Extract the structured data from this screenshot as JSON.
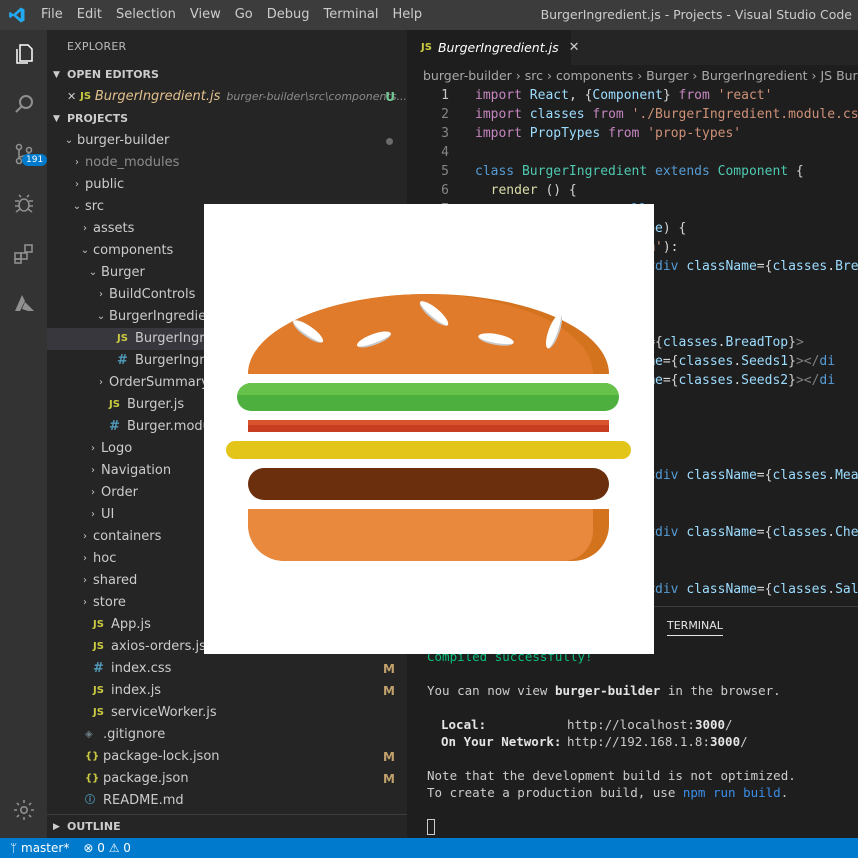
{
  "titlebar": {
    "menu": [
      "File",
      "Edit",
      "Selection",
      "View",
      "Go",
      "Debug",
      "Terminal",
      "Help"
    ],
    "title": "BurgerIngredient.js - Projects - Visual Studio Code"
  },
  "activity": {
    "icons": [
      "explorer-icon",
      "search-icon",
      "source-control-icon",
      "debug-icon",
      "extensions-icon",
      "azure-icon",
      "settings-gear-icon"
    ],
    "scm_badge": "191"
  },
  "sidebar": {
    "title": "EXPLORER",
    "open_editors_label": "OPEN EDITORS",
    "open_editor": {
      "close": "✕",
      "icon": "JS",
      "name": "BurgerIngredient.js",
      "path": "burger-builder\\src\\components...",
      "status": "U"
    },
    "projects_label": "PROJECTS",
    "tree": [
      {
        "indent": 0,
        "chev": "⌄",
        "icon": "",
        "name": "burger-builder",
        "mark": "",
        "dot": true
      },
      {
        "indent": 1,
        "chev": "›",
        "icon": "",
        "name": "node_modules",
        "mark": "",
        "dim": true
      },
      {
        "indent": 1,
        "chev": "›",
        "icon": "",
        "name": "public",
        "mark": ""
      },
      {
        "indent": 1,
        "chev": "⌄",
        "icon": "",
        "name": "src",
        "mark": ""
      },
      {
        "indent": 2,
        "chev": "›",
        "icon": "",
        "name": "assets",
        "mark": ""
      },
      {
        "indent": 2,
        "chev": "⌄",
        "icon": "",
        "name": "components",
        "mark": ""
      },
      {
        "indent": 3,
        "chev": "⌄",
        "icon": "",
        "name": "Burger",
        "mark": ""
      },
      {
        "indent": 4,
        "chev": "›",
        "icon": "",
        "name": "BuildControls",
        "mark": ""
      },
      {
        "indent": 4,
        "chev": "⌄",
        "icon": "",
        "name": "BurgerIngredient",
        "mark": ""
      },
      {
        "indent": 5,
        "chev": "",
        "icon": "JS",
        "name": "BurgerIngredient.js",
        "mark": "",
        "selected": true
      },
      {
        "indent": 5,
        "chev": "",
        "icon": "#",
        "name": "BurgerIngredient.module.css",
        "mark": ""
      },
      {
        "indent": 4,
        "chev": "›",
        "icon": "",
        "name": "OrderSummary",
        "mark": ""
      },
      {
        "indent": 4,
        "chev": "",
        "icon": "JS",
        "name": "Burger.js",
        "mark": ""
      },
      {
        "indent": 4,
        "chev": "",
        "icon": "#",
        "name": "Burger.module.css",
        "mark": ""
      },
      {
        "indent": 3,
        "chev": "›",
        "icon": "",
        "name": "Logo",
        "mark": ""
      },
      {
        "indent": 3,
        "chev": "›",
        "icon": "",
        "name": "Navigation",
        "mark": ""
      },
      {
        "indent": 3,
        "chev": "›",
        "icon": "",
        "name": "Order",
        "mark": ""
      },
      {
        "indent": 3,
        "chev": "›",
        "icon": "",
        "name": "UI",
        "mark": ""
      },
      {
        "indent": 2,
        "chev": "›",
        "icon": "",
        "name": "containers",
        "mark": ""
      },
      {
        "indent": 2,
        "chev": "›",
        "icon": "",
        "name": "hoc",
        "mark": ""
      },
      {
        "indent": 2,
        "chev": "›",
        "icon": "",
        "name": "shared",
        "mark": ""
      },
      {
        "indent": 2,
        "chev": "›",
        "icon": "",
        "name": "store",
        "mark": ""
      },
      {
        "indent": 2,
        "chev": "",
        "icon": "JS",
        "name": "App.js",
        "mark": ""
      },
      {
        "indent": 2,
        "chev": "",
        "icon": "JS",
        "name": "axios-orders.js",
        "mark": ""
      },
      {
        "indent": 2,
        "chev": "",
        "icon": "#",
        "name": "index.css",
        "mark": "M"
      },
      {
        "indent": 2,
        "chev": "",
        "icon": "JS",
        "name": "index.js",
        "mark": "M"
      },
      {
        "indent": 2,
        "chev": "",
        "icon": "JS",
        "name": "serviceWorker.js",
        "mark": ""
      },
      {
        "indent": 1,
        "chev": "",
        "icon": "◈",
        "name": ".gitignore",
        "mark": ""
      },
      {
        "indent": 1,
        "chev": "",
        "icon": "{}",
        "name": "package-lock.json",
        "mark": "M"
      },
      {
        "indent": 1,
        "chev": "",
        "icon": "{}",
        "name": "package.json",
        "mark": "M"
      },
      {
        "indent": 1,
        "chev": "",
        "icon": "ⓘ",
        "name": "README.md",
        "mark": ""
      }
    ],
    "outline_label": "OUTLINE"
  },
  "editor": {
    "tab": {
      "icon": "JS",
      "label": "BurgerIngredient.js",
      "close": "✕"
    },
    "breadcrumb": [
      "burger-builder",
      "src",
      "components",
      "Burger",
      "BurgerIngredient",
      "JS Burg"
    ],
    "lines": [
      {
        "n": 1,
        "html": "<span class='kw2'>import</span> <span class='attr'>React</span>, {<span class='attr'>Component</span>} <span class='kw2'>from</span> <span class='str'>'react'</span>"
      },
      {
        "n": 2,
        "html": "<span class='kw2'>import</span> <span class='attr'>classes</span> <span class='kw2'>from</span> <span class='str'>'./BurgerIngredient.module.css'</span>"
      },
      {
        "n": 3,
        "html": "<span class='kw2'>import</span> <span class='attr'>PropTypes</span> <span class='kw2'>from</span> <span class='str'>'prop-types'</span>"
      },
      {
        "n": 4,
        "html": ""
      },
      {
        "n": 5,
        "html": "<span class='kw'>class</span> <span class='cls'>BurgerIngredient</span> <span class='kw'>extends</span> <span class='cls'>Component</span> {"
      },
      {
        "n": 6,
        "html": "  <span class='fn'>render</span> () {"
      },
      {
        "n": 7,
        "html": "                    <span class='kw'>ll</span>"
      },
      {
        "n": 8,
        "html": "                   .<span class='attr'>type</span>) {"
      },
      {
        "n": 9,
        "html": "                   <span class='str'>ttom'</span>):"
      },
      {
        "n": 10,
        "html": "                      <span class='punc'>&lt;</span><span class='tag'>div</span> <span class='attr'>className</span>={<span class='attr'>classes</span>.<span class='attr'>Bre</span>"
      },
      {
        "n": 11,
        "html": ""
      },
      {
        "n": 12,
        "html": "                   <span class='str'>'</span>):"
      },
      {
        "n": 13,
        "html": "                      ("
      },
      {
        "n": 14,
        "html": "                   <span class='attr'>ame</span>={<span class='attr'>classes</span>.<span class='attr'>BreadTop</span>}<span class='punc'>&gt;</span>"
      },
      {
        "n": 15,
        "html": "                   <span class='attr'>sName</span>={<span class='attr'>classes</span>.<span class='attr'>Seeds1</span>}<span class='punc'>&gt;&lt;/</span><span class='tag'>di</span>"
      },
      {
        "n": 16,
        "html": "                   <span class='attr'>sName</span>={<span class='attr'>classes</span>.<span class='attr'>Seeds2</span>}<span class='punc'>&gt;&lt;/</span><span class='tag'>di</span>"
      },
      {
        "n": 17,
        "html": ""
      },
      {
        "n": 18,
        "html": ""
      },
      {
        "n": 19,
        "html": ""
      },
      {
        "n": 20,
        "html": ""
      },
      {
        "n": 21,
        "html": "                      <span class='punc'>&lt;</span><span class='tag'>div</span> <span class='attr'>className</span>={<span class='attr'>classes</span>.<span class='attr'>Mea</span>"
      },
      {
        "n": 22,
        "html": ""
      },
      {
        "n": 23,
        "html": ""
      },
      {
        "n": 24,
        "html": "                      <span class='punc'>&lt;</span><span class='tag'>div</span> <span class='attr'>className</span>={<span class='attr'>classes</span>.<span class='attr'>Che</span>"
      },
      {
        "n": 25,
        "html": ""
      },
      {
        "n": 26,
        "html": ""
      },
      {
        "n": 27,
        "html": "                      <span class='punc'>&lt;</span><span class='tag'>div</span> <span class='attr'>className</span>={<span class='attr'>classes</span>.<span class='attr'>Sal</span>"
      }
    ]
  },
  "panel": {
    "tab_label": "TERMINAL",
    "compiled": "Compiled successfully!",
    "view_prefix": "You can now view ",
    "app_name": "burger-builder",
    "view_suffix": " in the browser.",
    "local_label": "Local:",
    "local_url_prefix": "http://localhost:",
    "local_port": "3000",
    "local_url_suffix": "/",
    "network_label": "On Your Network:",
    "network_url_prefix": "http://192.168.1.8:",
    "network_port": "3000",
    "network_url_suffix": "/",
    "note1": "Note that the development build is not optimized.",
    "note2_prefix": "To create a production build, use ",
    "note2_cmd": "npm run build",
    "note2_suffix": "."
  },
  "status": {
    "branch": "master*",
    "errors": "0",
    "warnings": "0"
  },
  "colors": {
    "accent": "#007acc",
    "bun": "#d4731e",
    "salad": "#4caf3e",
    "bacon": "#c63d22",
    "cheese": "#e3c51a",
    "meat": "#6b2f0d"
  }
}
